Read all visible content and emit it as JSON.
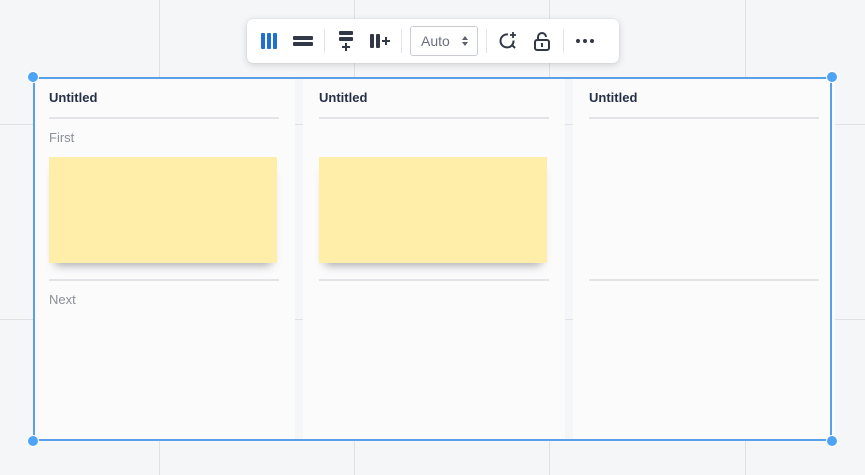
{
  "toolbar": {
    "columns_layout_icon": "columns-icon",
    "rows_layout_icon": "rows-icon",
    "add_row_icon": "add-row-icon",
    "add_column_icon": "add-column-icon",
    "size_select": {
      "value": "Auto"
    },
    "add_comment_icon": "add-comment-icon",
    "lock_icon": "unlock-icon",
    "more_icon": "more-icon"
  },
  "board": {
    "columns": [
      {
        "title": "Untitled",
        "lane1_label": "First",
        "lane2_label": "Next"
      },
      {
        "title": "Untitled",
        "lane1_label": "",
        "lane2_label": ""
      },
      {
        "title": "Untitled",
        "lane1_label": "",
        "lane2_label": ""
      }
    ]
  },
  "colors": {
    "selection": "#5aa0e8",
    "sticky": "#ffeeaa",
    "active_icon": "#1f6fd6",
    "icon": "#323846"
  }
}
